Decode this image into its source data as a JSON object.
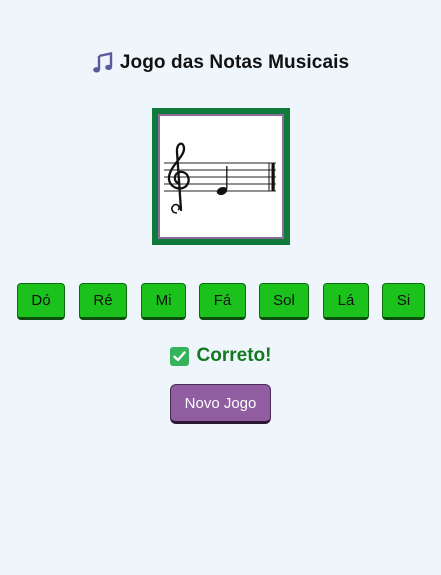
{
  "header": {
    "title": "Jogo das Notas Musicais",
    "icon": "music-notes-icon"
  },
  "staff": {
    "clef": "treble-clef",
    "note": "quarter-note",
    "note_position": "E4 (first line)"
  },
  "note_buttons": [
    {
      "label": "Dó"
    },
    {
      "label": "Ré"
    },
    {
      "label": "Mi"
    },
    {
      "label": "Fá"
    },
    {
      "label": "Sol"
    },
    {
      "label": "Lá"
    },
    {
      "label": "Si"
    }
  ],
  "result": {
    "icon": "check-mark-icon",
    "text": "Correto!",
    "color": "#137a1f"
  },
  "controls": {
    "new_game_label": "Novo Jogo"
  },
  "colors": {
    "background": "#eef6fc",
    "note_button": "#1cc21c",
    "frame": "#0f7a3c",
    "new_game_button": "#8f5da0"
  }
}
